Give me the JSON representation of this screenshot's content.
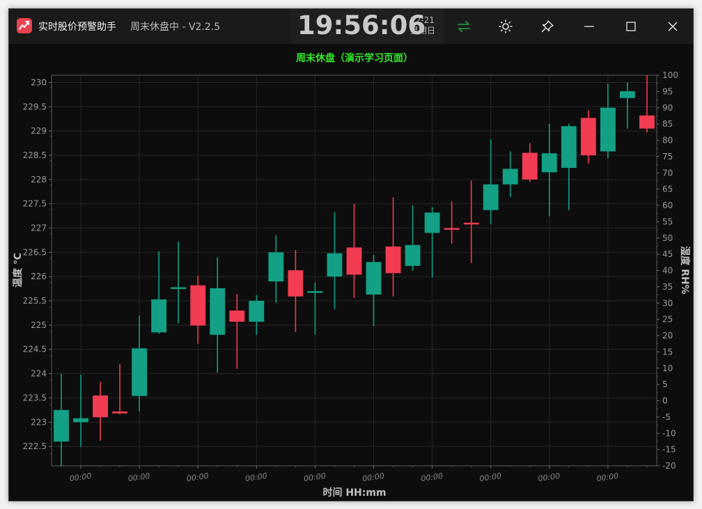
{
  "window": {
    "app_name": "实时股价预警助手",
    "status": "周末休盘中 - V2.2.5"
  },
  "clock": {
    "time": "19:56:06",
    "date": "12-21",
    "weekday": "星期日"
  },
  "title_bar_icons": {
    "swap": "swap-arrows-icon",
    "theme": "sun-icon",
    "pin": "pin-icon",
    "minimize": "minimize-icon",
    "maximize": "maximize-icon",
    "close": "close-icon"
  },
  "colors": {
    "up": "#13a085",
    "down": "#f13c52",
    "title": "#35e82e",
    "swap_icon": "#21a83a"
  },
  "chart_data": {
    "type": "candlestick",
    "title": "周末休盘（演示学习页面）",
    "xlabel": "时间 HH:mm",
    "ylabel_left": "温度 ℃",
    "ylabel_right": "湿度 RH%",
    "ylim_left": [
      222.1,
      230.15
    ],
    "ylim_right": [
      -20,
      100
    ],
    "left_ticks": [
      222.5,
      223,
      223.5,
      224,
      224.5,
      225,
      225.5,
      226,
      226.5,
      227,
      227.5,
      228,
      228.5,
      229,
      229.5,
      230
    ],
    "left_tick_labels": [
      "222.5",
      "223",
      "223.5",
      "224",
      "224.5",
      "225",
      "225.5",
      "226",
      "226.5",
      "227",
      "227.5",
      "228",
      "228.5",
      "229",
      "229.5",
      "230"
    ],
    "right_ticks": [
      -20,
      -15,
      -10,
      -5,
      0,
      5,
      10,
      15,
      20,
      25,
      30,
      35,
      40,
      45,
      50,
      55,
      60,
      65,
      70,
      75,
      80,
      85,
      90,
      95,
      100
    ],
    "x_tick_labels": [
      "00:00",
      "00:00",
      "00:00",
      "00:00",
      "00:00",
      "00:00",
      "00:00",
      "00:00",
      "00:00",
      "00:00"
    ],
    "grid": true,
    "candles": [
      {
        "open": 222.6,
        "high": 224.0,
        "low": 222.1,
        "close": 223.25
      },
      {
        "open": 223.0,
        "high": 223.98,
        "low": 222.49,
        "close": 223.08
      },
      {
        "open": 223.55,
        "high": 223.83,
        "low": 222.62,
        "close": 223.1
      },
      {
        "open": 223.22,
        "high": 224.2,
        "low": 223.16,
        "close": 223.18
      },
      {
        "open": 223.54,
        "high": 225.2,
        "low": 223.22,
        "close": 224.52
      },
      {
        "open": 224.85,
        "high": 226.52,
        "low": 224.82,
        "close": 225.53
      },
      {
        "open": 225.75,
        "high": 226.72,
        "low": 225.04,
        "close": 225.78
      },
      {
        "open": 225.82,
        "high": 226.02,
        "low": 224.62,
        "close": 224.99
      },
      {
        "open": 224.8,
        "high": 226.4,
        "low": 224.02,
        "close": 225.76
      },
      {
        "open": 225.3,
        "high": 225.64,
        "low": 224.1,
        "close": 225.07
      },
      {
        "open": 225.07,
        "high": 225.62,
        "low": 224.8,
        "close": 225.5
      },
      {
        "open": 225.9,
        "high": 226.85,
        "low": 225.46,
        "close": 226.5
      },
      {
        "open": 226.13,
        "high": 226.55,
        "low": 224.86,
        "close": 225.59
      },
      {
        "open": 225.68,
        "high": 225.88,
        "low": 224.8,
        "close": 225.7
      },
      {
        "open": 226.0,
        "high": 227.33,
        "low": 225.33,
        "close": 226.48
      },
      {
        "open": 226.6,
        "high": 227.5,
        "low": 225.56,
        "close": 226.04
      },
      {
        "open": 225.63,
        "high": 226.45,
        "low": 224.98,
        "close": 226.3
      },
      {
        "open": 226.62,
        "high": 227.63,
        "low": 225.59,
        "close": 226.07
      },
      {
        "open": 226.22,
        "high": 227.47,
        "low": 226.12,
        "close": 226.65
      },
      {
        "open": 226.9,
        "high": 227.43,
        "low": 225.98,
        "close": 227.32
      },
      {
        "open": 227.0,
        "high": 227.55,
        "low": 226.68,
        "close": 226.98
      },
      {
        "open": 227.11,
        "high": 227.98,
        "low": 226.28,
        "close": 227.08
      },
      {
        "open": 227.37,
        "high": 228.83,
        "low": 227.08,
        "close": 227.9
      },
      {
        "open": 227.9,
        "high": 228.58,
        "low": 227.64,
        "close": 228.22
      },
      {
        "open": 228.55,
        "high": 228.75,
        "low": 227.95,
        "close": 228.0
      },
      {
        "open": 228.15,
        "high": 229.15,
        "low": 227.24,
        "close": 228.54
      },
      {
        "open": 228.24,
        "high": 229.15,
        "low": 227.37,
        "close": 229.1
      },
      {
        "open": 229.27,
        "high": 229.43,
        "low": 228.33,
        "close": 228.5
      },
      {
        "open": 228.58,
        "high": 229.98,
        "low": 228.44,
        "close": 229.48
      },
      {
        "open": 229.68,
        "high": 230.0,
        "low": 229.05,
        "close": 229.82
      },
      {
        "open": 229.32,
        "high": 230.15,
        "low": 228.97,
        "close": 229.05
      }
    ]
  }
}
